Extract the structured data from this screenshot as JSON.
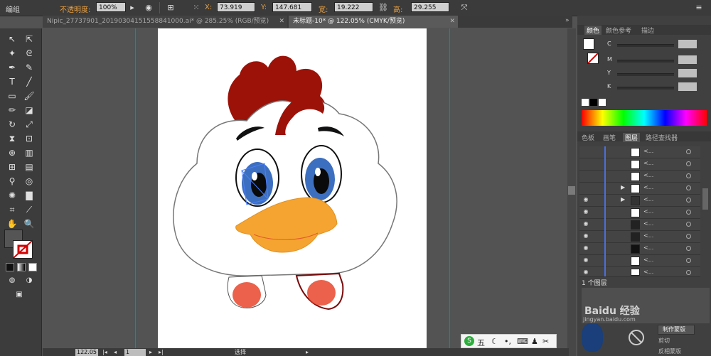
{
  "control_bar": {
    "mode_label": "编组",
    "opacity_label": "不透明度:",
    "opacity_value": "100%",
    "x_label": "X:",
    "x_value": "73.919",
    "y_label": "Y:",
    "y_value": "147.681",
    "w_label": "宽:",
    "w_value": "19.222",
    "h_label": "高:",
    "h_value": "29.255"
  },
  "tabs": [
    {
      "label": "Nipic_27737901_20190304151558841000.ai* @ 285.25% (RGB/预览)"
    },
    {
      "label": "未标题-10* @ 122.05% (CMYK/预览)"
    }
  ],
  "color_panel": {
    "tabs": [
      "颜色",
      "颜色参考",
      "描边"
    ],
    "channels": [
      "C",
      "M",
      "Y",
      "K"
    ]
  },
  "layers_panel": {
    "tabs": [
      "色板",
      "画笔",
      "图层",
      "路径查找器"
    ],
    "count_label": "1 个图层"
  },
  "watermark": {
    "site": "jingyan.baidu.com",
    "brand": "Baidu 经验"
  },
  "bottom_panel": {
    "make_mask": "制作蒙版",
    "clip": "剪切",
    "invert_mask": "反相蒙版"
  },
  "status_bar": {
    "zoom": "122.05",
    "page": "1",
    "tool": "选择"
  },
  "ime": {
    "brand": "S",
    "mode": "五"
  },
  "colors": {
    "comb": "#9c1208",
    "beak": "#f5a431",
    "iris": "#3d6fc0",
    "cheek": "#e8452c",
    "accent_orange": "#e8a040",
    "guide_red": "#c8403f"
  }
}
